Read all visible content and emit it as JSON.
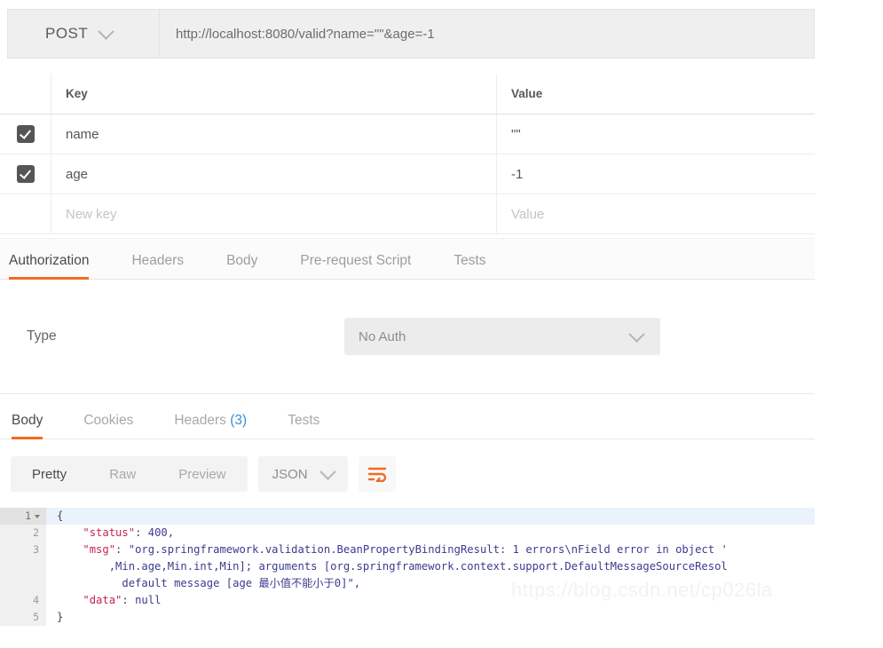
{
  "request": {
    "method": "POST",
    "method_caret_icon": "chevron-down-icon",
    "url": "http://localhost:8080/valid?name=\"\"&age=-1"
  },
  "params_table": {
    "headers": {
      "key": "Key",
      "value": "Value"
    },
    "rows": [
      {
        "checked": true,
        "key": "name",
        "value": "\"\""
      },
      {
        "checked": true,
        "key": "age",
        "value": "-1"
      },
      {
        "checked": false,
        "key": "New key",
        "value": "Value"
      }
    ]
  },
  "request_tabs": {
    "items": [
      {
        "label": "Authorization",
        "active": true
      },
      {
        "label": "Headers",
        "active": false
      },
      {
        "label": "Body",
        "active": false
      },
      {
        "label": "Pre-request Script",
        "active": false
      },
      {
        "label": "Tests",
        "active": false
      }
    ],
    "active_underline_color": "#f26b21"
  },
  "authorization": {
    "type_label": "Type",
    "type_value": "No Auth",
    "type_caret_icon": "chevron-down-icon"
  },
  "response_tabs": {
    "items": [
      {
        "label": "Body",
        "active": true
      },
      {
        "label": "Cookies",
        "active": false
      },
      {
        "label": "Headers",
        "active": false,
        "count": "(3)"
      },
      {
        "label": "Tests",
        "active": false
      }
    ],
    "count_color": "#3a8fd6"
  },
  "body_toolbar": {
    "views": [
      {
        "label": "Pretty",
        "active": true
      },
      {
        "label": "Raw",
        "active": false
      },
      {
        "label": "Preview",
        "active": false
      }
    ],
    "format": "JSON",
    "format_caret_icon": "chevron-down-icon",
    "wrap_icon": "word-wrap-icon",
    "wrap_icon_color": "#f26b21"
  },
  "response_body": {
    "lines": [
      {
        "number": "1",
        "foldable": true,
        "highlighted": true,
        "segments": [
          {
            "t": "{",
            "c": "punct"
          }
        ]
      },
      {
        "number": "2",
        "foldable": false,
        "highlighted": false,
        "segments": [
          {
            "t": "    ",
            "c": "punct"
          },
          {
            "t": "\"status\"",
            "c": "key"
          },
          {
            "t": ": ",
            "c": "punct"
          },
          {
            "t": "400,",
            "c": "val"
          }
        ]
      },
      {
        "number": "3",
        "foldable": false,
        "highlighted": false,
        "segments": [
          {
            "t": "    ",
            "c": "punct"
          },
          {
            "t": "\"msg\"",
            "c": "key"
          },
          {
            "t": ": ",
            "c": "punct"
          },
          {
            "t": "\"org.springframework.validation.BeanPropertyBindingResult: 1 errors\\nField error in object '",
            "c": "val"
          }
        ]
      },
      {
        "number": "",
        "foldable": false,
        "highlighted": false,
        "segments": [
          {
            "t": "        ,Min.age,Min.int,Min]; arguments [org.springframework.context.support.DefaultMessageSourceResol",
            "c": "val"
          }
        ]
      },
      {
        "number": "",
        "foldable": false,
        "highlighted": false,
        "segments": [
          {
            "t": "          default message [age 最小值不能小于0]\",",
            "c": "val"
          }
        ]
      },
      {
        "number": "4",
        "foldable": false,
        "highlighted": false,
        "segments": [
          {
            "t": "    ",
            "c": "punct"
          },
          {
            "t": "\"data\"",
            "c": "key"
          },
          {
            "t": ": ",
            "c": "punct"
          },
          {
            "t": "null",
            "c": "val"
          }
        ]
      },
      {
        "number": "5",
        "foldable": false,
        "highlighted": false,
        "segments": [
          {
            "t": "}",
            "c": "punct"
          }
        ]
      }
    ]
  },
  "watermark": {
    "text": "https://blog.csdn.net/cp026la"
  }
}
